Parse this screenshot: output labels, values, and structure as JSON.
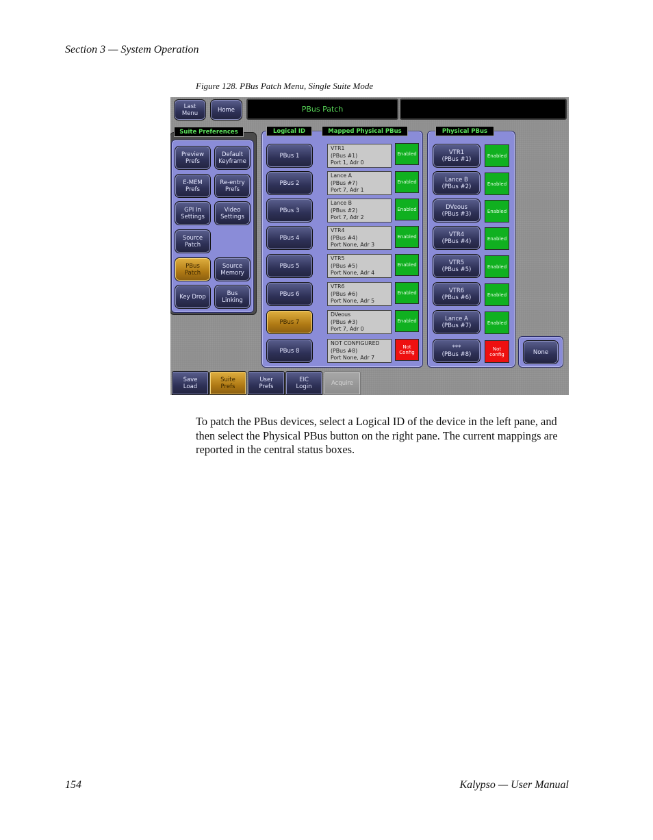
{
  "page": {
    "section": "Section 3 — System Operation",
    "caption": "Figure 128.  PBus Patch Menu, Single Suite Mode",
    "body": "To patch the PBus devices, select a Logical ID of the device in the left pane, and then select the Physical PBus button on the right pane. The current mappings are reported in the central status boxes.",
    "page_number": "154",
    "manual": "Kalypso — User Manual"
  },
  "screen": {
    "last_menu": "Last\nMenu",
    "home": "Home",
    "title": "PBus Patch",
    "suite_prefs_label": "Suite Preferences",
    "pref_buttons": [
      "Preview\nPrefs",
      "Default\nKeyframe",
      "E-MEM\nPrefs",
      "Re-entry\nPrefs",
      "GPI In\nSettings",
      "Video\nSettings",
      "Source\nPatch",
      "PBus\nPatch",
      "Source\nMemory",
      "Key Drop",
      "Bus\nLinking"
    ],
    "logical_label": "Logical ID",
    "mapped_label": "Mapped Physical PBus",
    "physical_label": "Physical PBus",
    "logical": [
      "PBus 1",
      "PBus 2",
      "PBus 3",
      "PBus 4",
      "PBus 5",
      "PBus 6",
      "PBus 7",
      "PBus 8"
    ],
    "mapped": [
      "VTR1\n(PBus #1)\nPort 1, Adr 0",
      "Lance A\n(PBus #7)\nPort 7, Adr 1",
      "Lance B\n(PBus #2)\nPort 7, Adr 2",
      "VTR4\n(PBus #4)\nPort None, Adr 3",
      "VTR5\n(PBus #5)\nPort None, Adr 4",
      "VTR6\n(PBus #6)\nPort None, Adr 5",
      "DVeous\n(PBus #3)\nPort 7, Adr 0",
      "NOT CONFIGURED\n(PBus #8)\nPort None, Adr 7"
    ],
    "mapped_status": [
      "Enabled",
      "Enabled",
      "Enabled",
      "Enabled",
      "Enabled",
      "Enabled",
      "Enabled",
      "Not\nConfig"
    ],
    "physical": [
      "VTR1\n(PBus #1)",
      "Lance B\n(PBus #2)",
      "DVeous\n(PBus #3)",
      "VTR4\n(PBus #4)",
      "VTR5\n(PBus #5)",
      "VTR6\n(PBus #6)",
      "Lance A\n(PBus #7)",
      "***\n(PBus #8)"
    ],
    "physical_status": [
      "Enabled",
      "Enabled",
      "Enabled",
      "Enabled",
      "Enabled",
      "Enabled",
      "Enabled",
      "Not\nconfig"
    ],
    "none": "None",
    "tabs": [
      "Save\nLoad",
      "Suite\nPrefs",
      "User\nPrefs",
      "EIC\nLogin",
      "Acquire"
    ]
  }
}
